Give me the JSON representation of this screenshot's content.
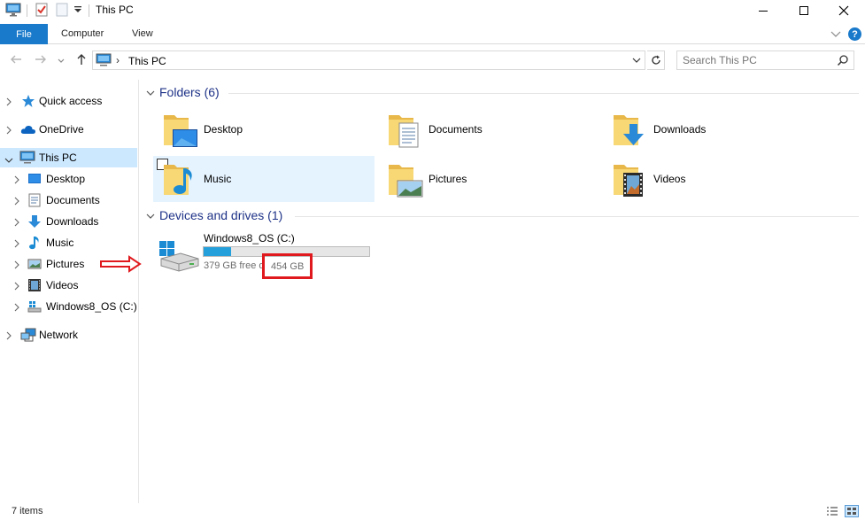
{
  "window": {
    "title": "This PC",
    "minimize_glyph": "─",
    "maximize_glyph": "☐",
    "close_glyph": "✕"
  },
  "ribbon": {
    "tabs": [
      {
        "label": "File",
        "active": true
      },
      {
        "label": "Computer"
      },
      {
        "label": "View"
      }
    ]
  },
  "address": {
    "path": "This PC",
    "separator": "›"
  },
  "search": {
    "placeholder": "Search This PC"
  },
  "nav_pane": {
    "items": [
      {
        "label": "Quick access",
        "icon": "star-icon"
      },
      {
        "label": "OneDrive",
        "icon": "cloud-icon"
      },
      {
        "label": "This PC",
        "icon": "computer-icon",
        "selected": true,
        "expanded": true
      },
      {
        "label": "Desktop",
        "icon": "desktop-icon"
      },
      {
        "label": "Documents",
        "icon": "documents-icon"
      },
      {
        "label": "Downloads",
        "icon": "download-icon"
      },
      {
        "label": "Music",
        "icon": "music-icon"
      },
      {
        "label": "Pictures",
        "icon": "pictures-icon"
      },
      {
        "label": "Videos",
        "icon": "videos-icon"
      },
      {
        "label": "Windows8_OS (C:)",
        "icon": "drive-icon"
      },
      {
        "label": "Network",
        "icon": "network-icon"
      }
    ]
  },
  "folders": {
    "header": "Folders (6)",
    "items": [
      {
        "label": "Desktop",
        "icon": "desktop-folder-icon"
      },
      {
        "label": "Documents",
        "icon": "documents-folder-icon"
      },
      {
        "label": "Downloads",
        "icon": "downloads-folder-icon"
      },
      {
        "label": "Music",
        "icon": "music-folder-icon",
        "hovered": true
      },
      {
        "label": "Pictures",
        "icon": "pictures-folder-icon"
      },
      {
        "label": "Videos",
        "icon": "videos-folder-icon"
      }
    ]
  },
  "drives": {
    "header": "Devices and drives (1)",
    "items": [
      {
        "name": "Windows8_OS (C:)",
        "free_text": "379 GB free o",
        "total_text": "454 GB",
        "used_fraction": 0.165,
        "icon": "windows-drive-icon"
      }
    ]
  },
  "status": {
    "item_count": "7 items"
  },
  "colors": {
    "accent": "#1979ca",
    "selection": "#cce8ff",
    "hover": "#e5f3ff",
    "group_header": "#1e3287",
    "drive_bar": "#26a0da",
    "annotation": "#e0191e"
  }
}
